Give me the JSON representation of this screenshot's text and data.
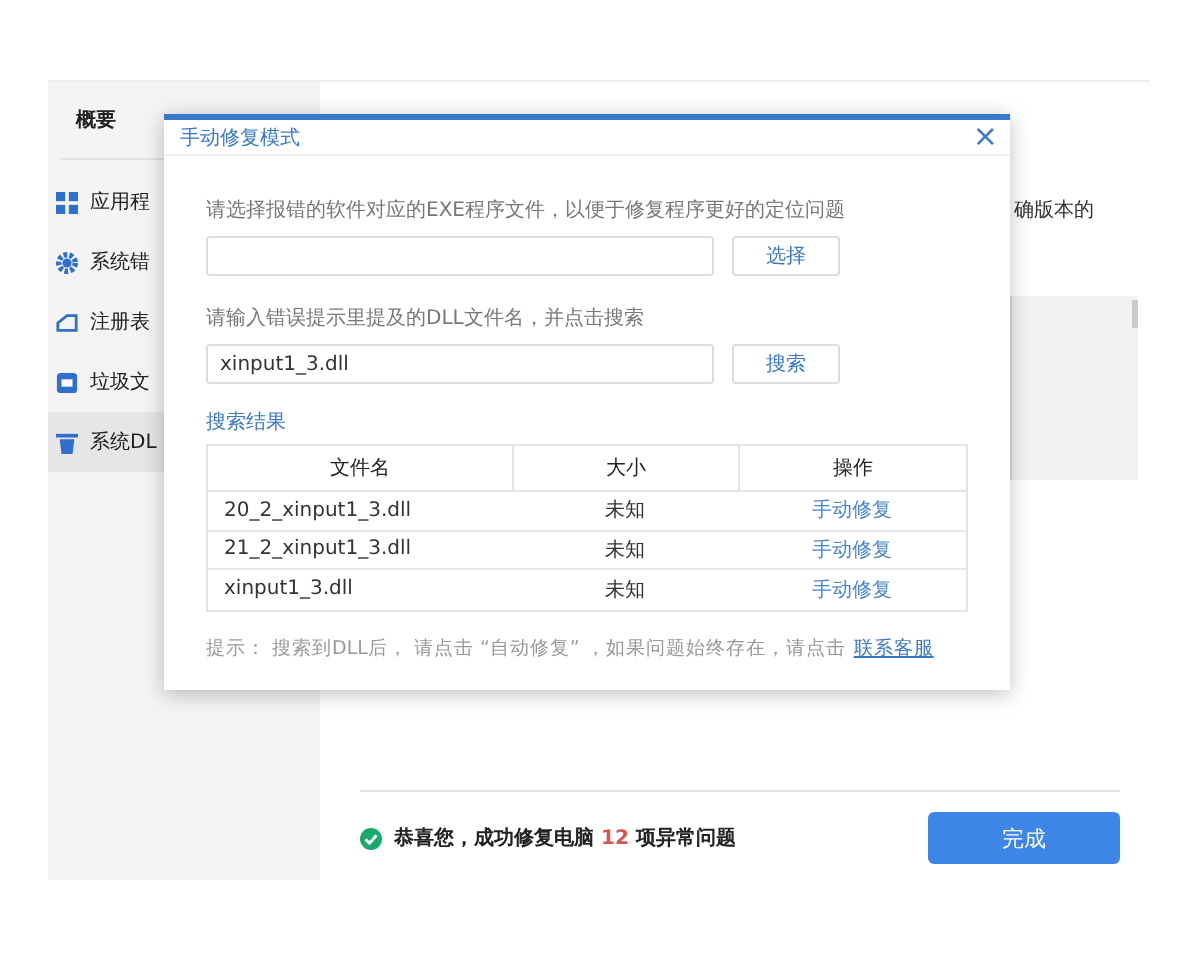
{
  "sidebar": {
    "heading": "概要",
    "items": [
      {
        "label": "应用程",
        "selected": false
      },
      {
        "label": "系统错",
        "selected": false
      },
      {
        "label": "注册表",
        "selected": false
      },
      {
        "label": "垃圾文",
        "selected": false
      },
      {
        "label": "系统DL",
        "selected": true
      }
    ]
  },
  "main": {
    "text_fragment": "确版本的",
    "result": {
      "before": "恭喜您，成功修复电脑",
      "count": "12",
      "after": "项异常问题"
    },
    "done_button": "完成"
  },
  "dialog": {
    "title": "手动修复模式",
    "close": "×",
    "exe_label": "请选择报错的软件对应的EXE程序文件，以便于修复程序更好的定位问题",
    "exe_button": "选择",
    "dll_label": "请输入错误提示里提及的DLL文件名，并点击搜索",
    "dll_value": "xinput1_3.dll",
    "dll_button": "搜索",
    "results_title": "搜索结果",
    "table": {
      "columns": [
        "文件名",
        "大小",
        "操作"
      ],
      "rows": [
        {
          "file": "20_2_xinput1_3.dll",
          "size": "未知",
          "action": "手动修复"
        },
        {
          "file": "21_2_xinput1_3.dll",
          "size": "未知",
          "action": "手动修复"
        },
        {
          "file": "xinput1_3.dll",
          "size": "未知",
          "action": "手动修复"
        }
      ]
    },
    "hint": "提示： 搜索到DLL后， 请点击 “自动修复” ，如果问题始终存在，请点击",
    "hint_link": "联系客服"
  }
}
